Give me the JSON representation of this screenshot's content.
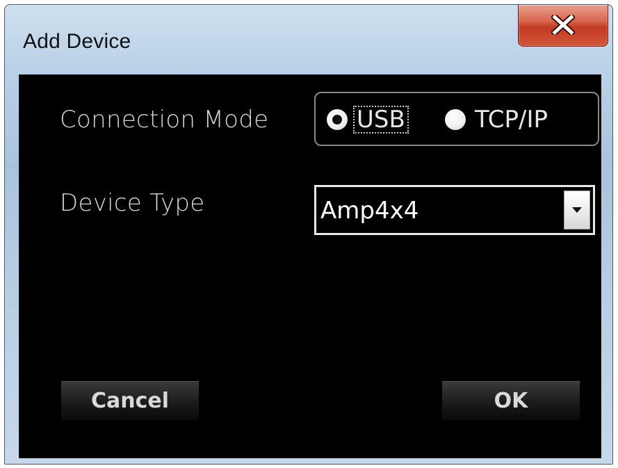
{
  "window": {
    "title": "Add Device",
    "close_glyph": "close-icon"
  },
  "form": {
    "connection_mode_label": "Connection Mode",
    "connection_options": [
      {
        "label": "USB",
        "selected": true
      },
      {
        "label": "TCP/IP",
        "selected": false
      }
    ],
    "device_type_label": "Device Type",
    "device_type_value": "Amp4x4"
  },
  "buttons": {
    "cancel_label": "Cancel",
    "ok_label": "OK"
  },
  "colors": {
    "close_button": "#c23b22",
    "client_background": "#000000",
    "text": "#d8d8d8"
  }
}
